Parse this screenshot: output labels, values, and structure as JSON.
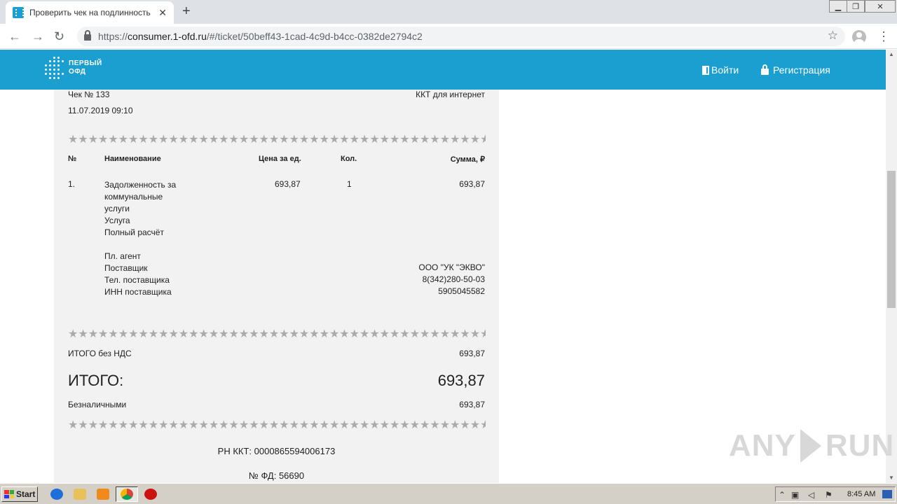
{
  "browser": {
    "tab_title": "Проверить чек на подлинность он",
    "url_scheme": "https://",
    "url_host": "consumer.1-ofd.ru",
    "url_path": "/#/ticket/50beff43-1cad-4c9d-b4cc-0382de2794c2"
  },
  "header": {
    "logo_line1": "ПЕРВЫЙ",
    "logo_line2": "ОФД",
    "login_label": "Войти",
    "register_label": "Регистрация"
  },
  "receipt": {
    "check_number": "Чек № 133",
    "kkt_type": "ККТ для интернет",
    "datetime": "11.07.2019 09:10",
    "stars": "★★★★★★★★★★★★★★★★★★★★★★★★★★★★★★★★★★★★★★★★★★★★★★★★★★★★★★★★★★★★★★",
    "columns": {
      "num": "№",
      "name": "Наименование",
      "price": "Цена за ед.",
      "qty": "Кол.",
      "sum": "Сумма, ₽"
    },
    "item": {
      "num": "1.",
      "name_line1": "Задолженность за",
      "name_line2": "коммунальные",
      "name_line3": "услуги",
      "type": "Услуга",
      "payment_method": "Полный расчёт",
      "price": "693,87",
      "qty": "1",
      "sum": "693,87",
      "agent_label": "Пл. агент",
      "supplier_label": "Поставщик",
      "supplier_value": "ООО \"УК \"ЭКВО\"",
      "supplier_phone_label": "Тел. поставщика",
      "supplier_phone_value": "8(342)280-50-03",
      "supplier_inn_label": "ИНН поставщика",
      "supplier_inn_value": "5905045582"
    },
    "total_no_vat_label": "ИТОГО без НДС",
    "total_no_vat_value": "693,87",
    "total_label": "ИТОГО:",
    "total_value": "693,87",
    "cashless_label": "Безналичными",
    "cashless_value": "693,87",
    "rn_kkt": "РН ККТ: 0000865594006173",
    "fd_number": "№ ФД: 56690"
  },
  "watermark": {
    "left": "ANY",
    "right": "RUN"
  },
  "taskbar": {
    "start_label": "Start",
    "clock": "8:45 AM"
  }
}
